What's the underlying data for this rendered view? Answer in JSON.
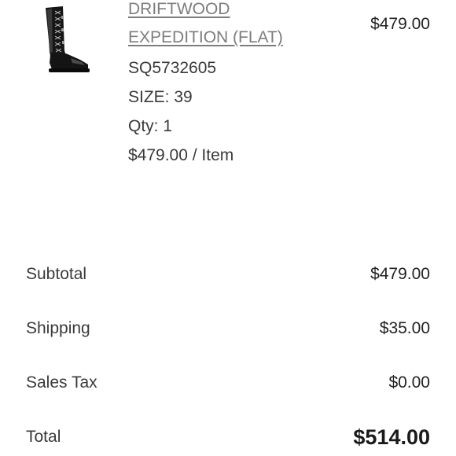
{
  "item": {
    "name_line1": "DRIFTWOOD",
    "name_line2": "EXPEDITION (FLAT)",
    "sku": "SQ5732605",
    "size": "SIZE: 39",
    "qty": "Qty: 1",
    "unit_price": "$479.00 / Item",
    "price": "$479.00",
    "image_icon": "tall-lace-up-boot-image"
  },
  "summary": {
    "subtotal_label": "Subtotal",
    "subtotal_value": "$479.00",
    "shipping_label": "Shipping",
    "shipping_value": "$35.00",
    "tax_label": "Sales Tax",
    "tax_value": "$0.00",
    "total_label": "Total",
    "total_value": "$514.00"
  }
}
